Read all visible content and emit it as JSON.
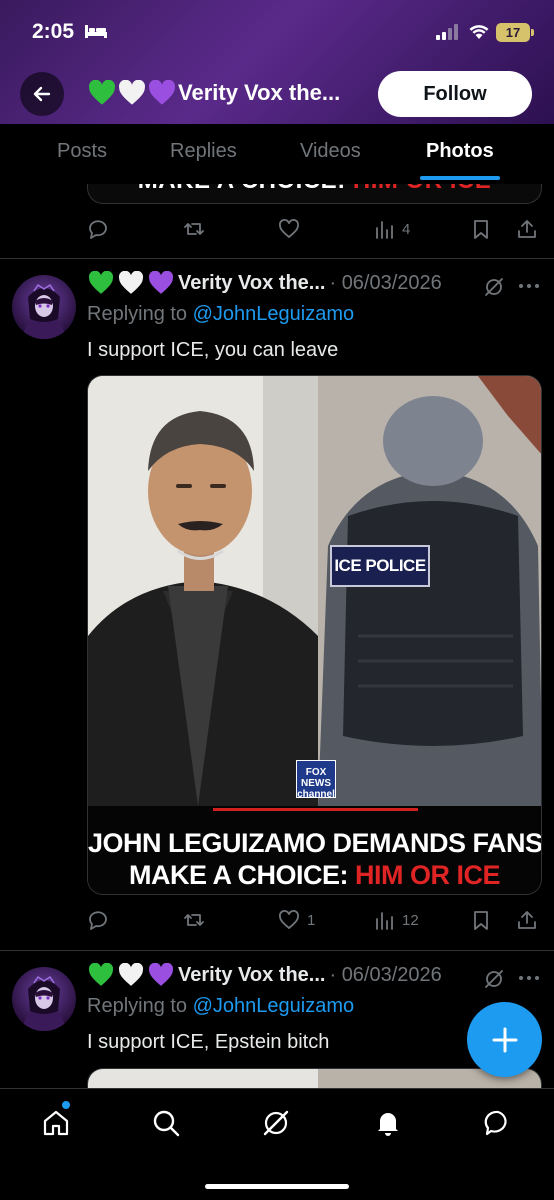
{
  "status_bar": {
    "time": "2:05",
    "battery": "17"
  },
  "header": {
    "title": "Verity Vox the...",
    "hearts": [
      "#2fbf3f",
      "#f2f2f2",
      "#9b4fe0"
    ],
    "follow_label": "Follow"
  },
  "tabs": [
    {
      "label": "Posts",
      "active": false
    },
    {
      "label": "Replies",
      "active": false
    },
    {
      "label": "Videos",
      "active": false
    },
    {
      "label": "Photos",
      "active": true
    }
  ],
  "previous_post": {
    "media_text": "MAKE A CHOICE: ",
    "media_text_red": "HIM OR ICE",
    "views": "4"
  },
  "posts": [
    {
      "name": "Verity Vox the...",
      "date": "06/03/2026",
      "replying_prefix": "Replying to ",
      "replying_handle": "@JohnLeguizamo",
      "text": "I support ICE, you can leave",
      "media": {
        "caption_line1": "JOHN LEGUIZAMO DEMANDS FANS",
        "caption_line2": "MAKE A CHOICE: ",
        "caption_red": "HIM OR ICE",
        "fox_logo": "FOX NEWS channel",
        "patch": "ICE POLICE"
      },
      "likes": "1",
      "views": "12"
    },
    {
      "name": "Verity Vox the...",
      "date": "06/03/2026",
      "replying_prefix": "Replying to ",
      "replying_handle": "@JohnLeguizamo",
      "text": "I support ICE, Epstein bitch"
    }
  ],
  "colors": {
    "accent": "#1d9bf0",
    "muted": "#71767b",
    "header_purple": "#5a2a8a"
  }
}
